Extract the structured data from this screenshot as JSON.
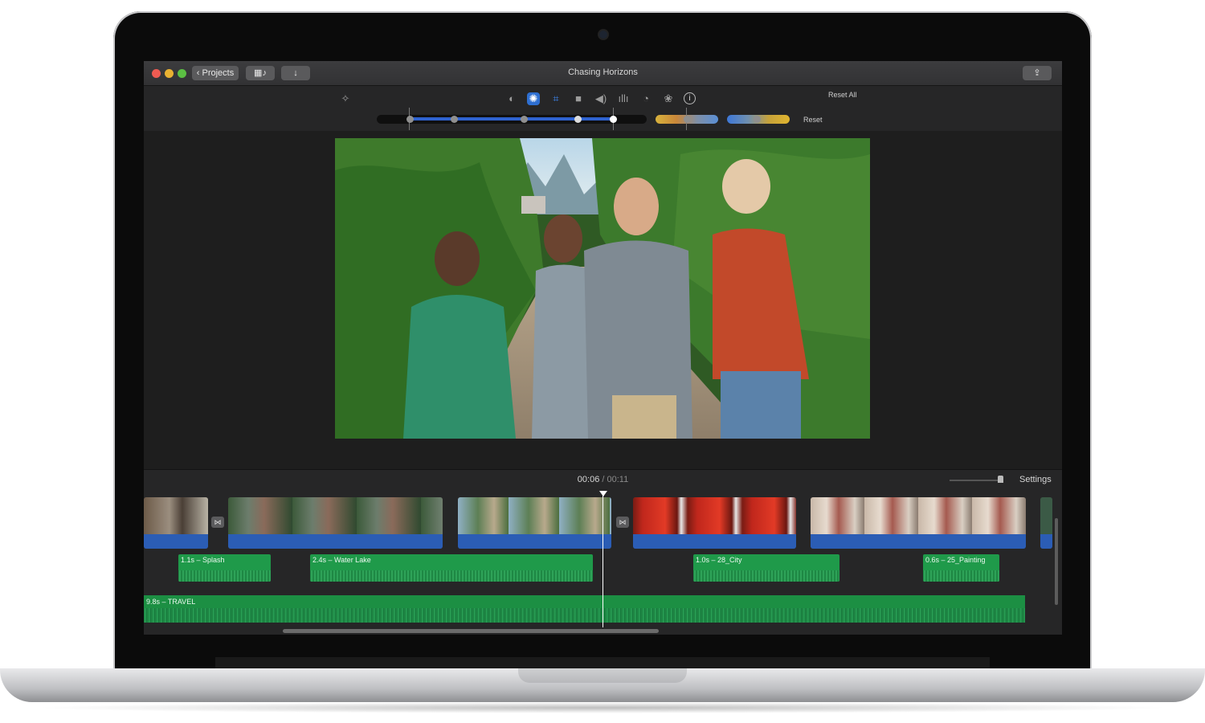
{
  "window": {
    "title": "Chasing Horizons",
    "back_label": "Projects"
  },
  "toolbar": {
    "reset_all_label": "Reset All",
    "reset_label": "Reset",
    "icons": [
      "magic-wand-icon",
      "color-balance-icon",
      "color-correction-icon",
      "crop-icon",
      "stabilization-icon",
      "volume-icon",
      "noise-reduction-icon",
      "speed-icon",
      "video-overlay-icon",
      "info-icon"
    ]
  },
  "timeline": {
    "current_time": "00:06",
    "separator": " / ",
    "duration": "00:11",
    "settings_label": "Settings",
    "sfx_clips": [
      {
        "label": "1.1s – Splash"
      },
      {
        "label": "2.4s – Water Lake"
      },
      {
        "label": "1.0s – 28_City"
      },
      {
        "label": "0.6s – 25_Painting"
      }
    ],
    "music": {
      "label": "9.8s – TRAVEL"
    }
  },
  "colors": {
    "accent_blue": "#2b5db5",
    "audio_green": "#1f9a4a",
    "window_bg": "#1e1e1e"
  }
}
